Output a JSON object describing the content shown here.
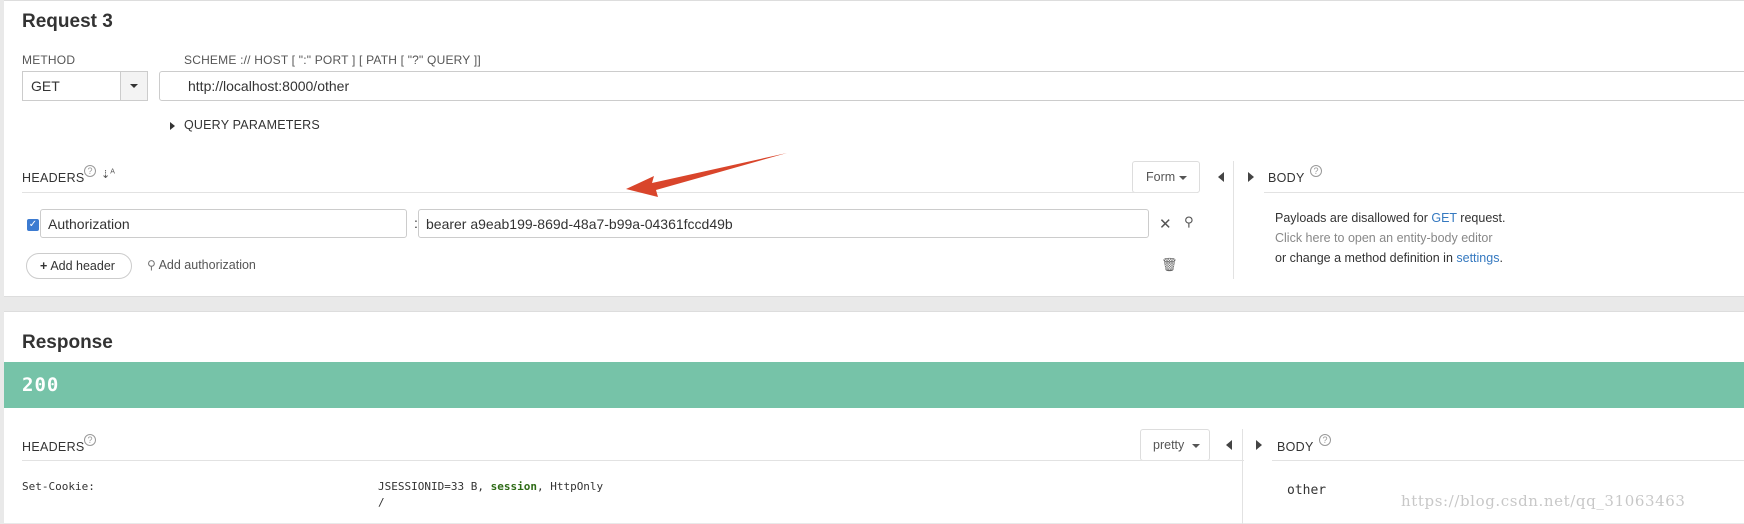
{
  "request": {
    "title": "Request 3",
    "method_label": "METHOD",
    "method_value": "GET",
    "url_label": "SCHEME :// HOST [ \":\" PORT ] [ PATH [ \"?\" QUERY ]]",
    "url_value": "http://localhost:8000/other",
    "query_parameters_label": "QUERY PARAMETERS",
    "headers_label": "HEADERS",
    "form_button_label": "Form",
    "header_rows": [
      {
        "enabled": true,
        "name": "Authorization",
        "value": "bearer a9eab199-869d-48a7-b99a-04361fccd49b"
      }
    ],
    "add_header_label": "Add header",
    "add_authorization_label": "Add authorization",
    "body_label": "BODY",
    "body_message": {
      "line1_prefix": "Payloads are disallowed for ",
      "line1_link": "GET",
      "line1_suffix": " request.",
      "line2": "Click here to open an entity-body editor",
      "line3_prefix": "or change a method definition in ",
      "line3_link": "settings",
      "line3_suffix": "."
    }
  },
  "response": {
    "title": "Response",
    "status_code": "200",
    "headers_label": "HEADERS",
    "pretty_button_label": "pretty",
    "body_label": "BODY",
    "header_rows": [
      {
        "name": "Set-Cookie:",
        "value_prefix": "JSESSIONID=33 B, ",
        "value_highlight": "session",
        "value_suffix": ", HttpOnly",
        "value_line2": "/"
      }
    ],
    "body_content": "other"
  },
  "watermark": "https://blog.csdn.net/qq_31063463",
  "colors": {
    "status_bar": "#76c3a8",
    "link": "#3579c0",
    "checkbox": "#3c7bd1",
    "annotation_arrow": "#d9452b"
  },
  "icons": [
    "help-icon",
    "sort-icon",
    "caret-down-icon",
    "collapse-left-icon",
    "expand-right-icon",
    "checkbox-icon",
    "close-icon",
    "key-icon",
    "plus-icon",
    "trash-icon"
  ]
}
